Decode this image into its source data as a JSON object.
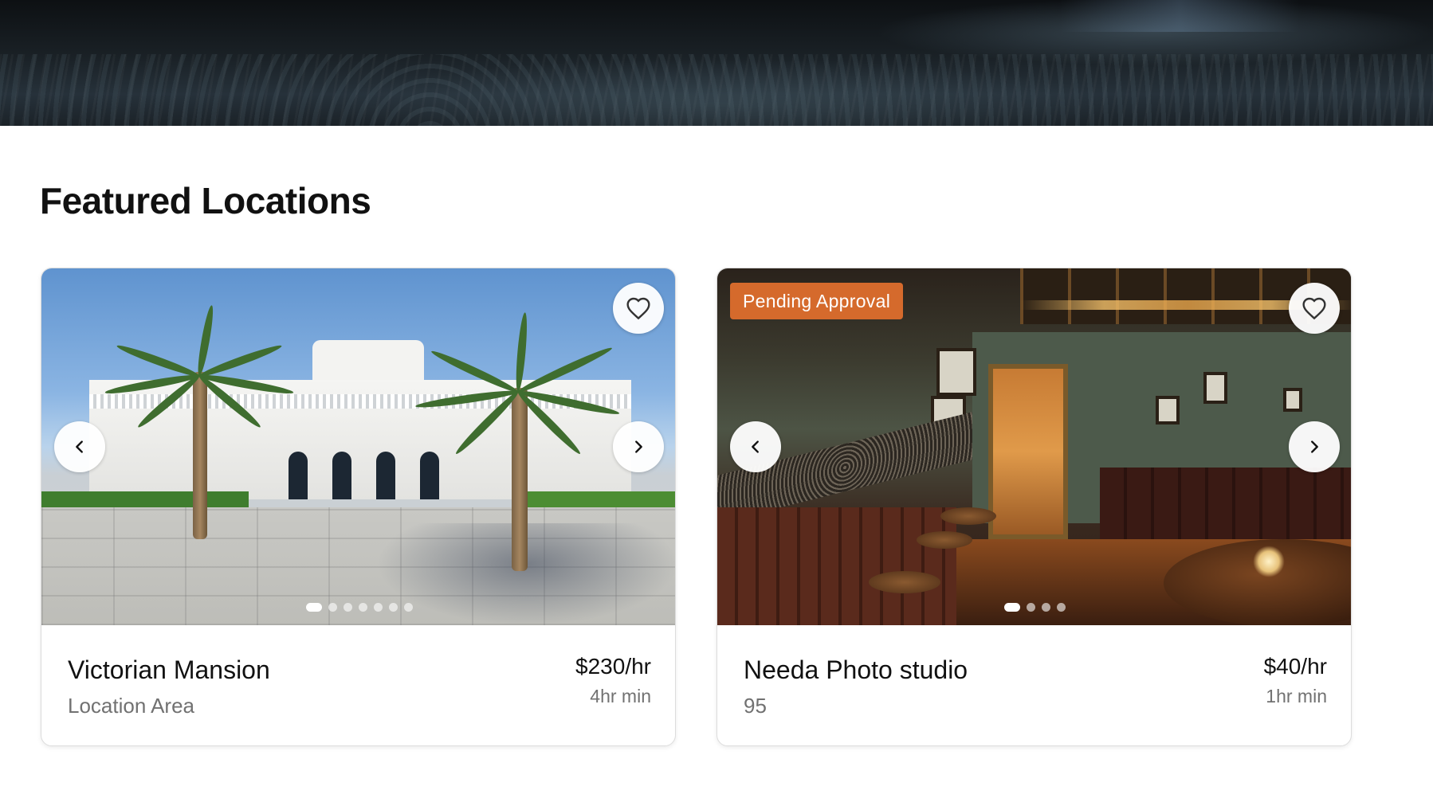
{
  "section": {
    "title": "Featured Locations"
  },
  "cards": [
    {
      "name": "Victorian Mansion",
      "area": "Location Area",
      "price": "$230/hr",
      "minimum": "4hr min",
      "badge": "",
      "image_count": 7,
      "active_image": 0
    },
    {
      "name": "Needa Photo studio",
      "area": "95",
      "price": "$40/hr",
      "minimum": "1hr min",
      "badge": "Pending Approval",
      "image_count": 4,
      "active_image": 0
    }
  ],
  "icons": {
    "favorite": "heart-outline-icon",
    "prev": "chevron-left-icon",
    "next": "chevron-right-icon"
  },
  "colors": {
    "badge": "#d56a2c",
    "muted_text": "#717171"
  }
}
